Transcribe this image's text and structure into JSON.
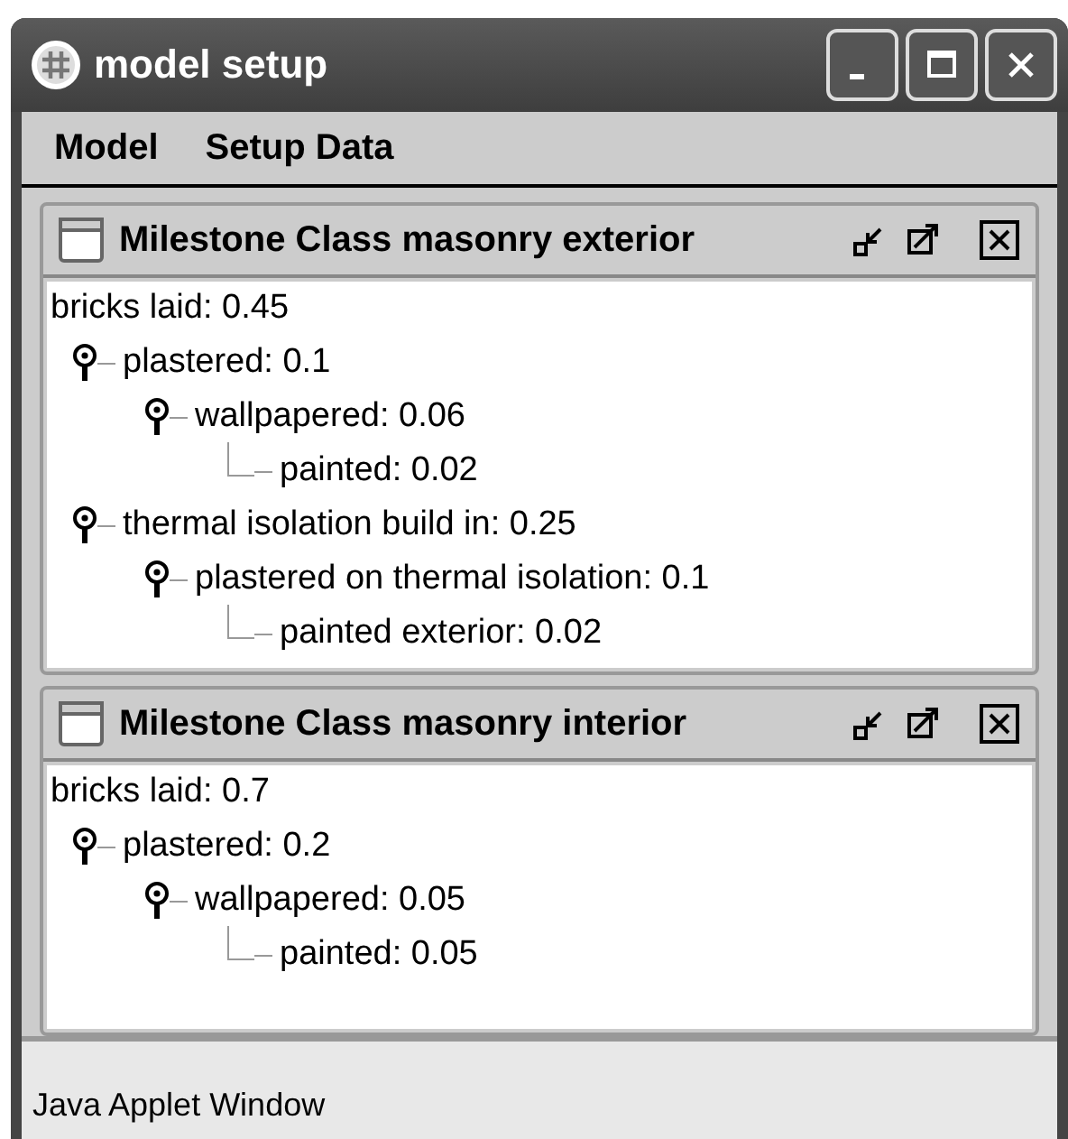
{
  "window": {
    "title": "model setup"
  },
  "menu": [
    "Model",
    "Setup Data"
  ],
  "frames": [
    {
      "title": "Milestone Class masonry exterior",
      "tree": {
        "label": "bricks laid: 0.45",
        "children": [
          {
            "label": "plastered: 0.1",
            "children": [
              {
                "label": "wallpapered: 0.06",
                "children": [
                  {
                    "label": "painted: 0.02"
                  }
                ]
              }
            ]
          },
          {
            "label": "thermal isolation build in: 0.25",
            "children": [
              {
                "label": "plastered on thermal isolation: 0.1",
                "children": [
                  {
                    "label": "painted exterior: 0.02"
                  }
                ]
              }
            ]
          }
        ]
      }
    },
    {
      "title": "Milestone Class masonry interior",
      "tree": {
        "label": "bricks laid: 0.7",
        "children": [
          {
            "label": "plastered: 0.2",
            "children": [
              {
                "label": "wallpapered: 0.05",
                "children": [
                  {
                    "label": "painted: 0.05"
                  }
                ]
              }
            ]
          }
        ]
      }
    }
  ],
  "status_bar": "Java Applet Window"
}
